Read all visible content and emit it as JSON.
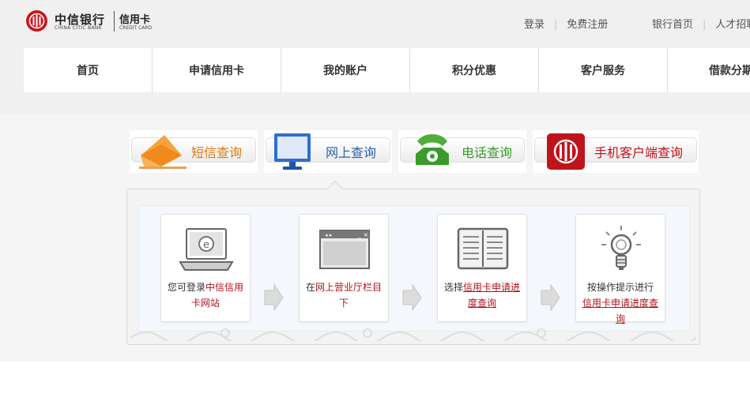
{
  "brand": {
    "cn": "中信银行",
    "en": "CHINA CITIC BANK",
    "product_cn": "信用卡",
    "product_en": "CREDIT CARD",
    "color": "#c8161d"
  },
  "toplinks": {
    "login": "登录",
    "register": "免费注册",
    "bank_home": "银行首页",
    "jobs": "人才招聘"
  },
  "nav": [
    "首页",
    "申请信用卡",
    "我的账户",
    "积分优惠",
    "客户服务",
    "借款分期"
  ],
  "tabs": [
    {
      "label": "短信查询",
      "color": "#e07a14",
      "icon": "envelope-icon"
    },
    {
      "label": "网上查询",
      "color": "#2f5fae",
      "icon": "monitor-icon"
    },
    {
      "label": "电话查询",
      "color": "#3a9b2a",
      "icon": "phone-icon"
    },
    {
      "label": "手机客户端查询",
      "color": "#c0141c",
      "icon": "citic-app-icon"
    }
  ],
  "steps": [
    {
      "pre": "您可登录",
      "link": "中信信用卡网站",
      "post": "",
      "icon": "laptop-icon"
    },
    {
      "pre": "在",
      "link": "网上营业厅栏目下",
      "post": "",
      "icon": "browser-window-icon"
    },
    {
      "pre": "选择",
      "link": "信用卡申请进度查询",
      "post": "",
      "icon": "book-icon"
    },
    {
      "pre": "按操作提示进行",
      "link": "信用卡申请进度查询",
      "post": "",
      "icon": "lightbulb-icon"
    }
  ]
}
